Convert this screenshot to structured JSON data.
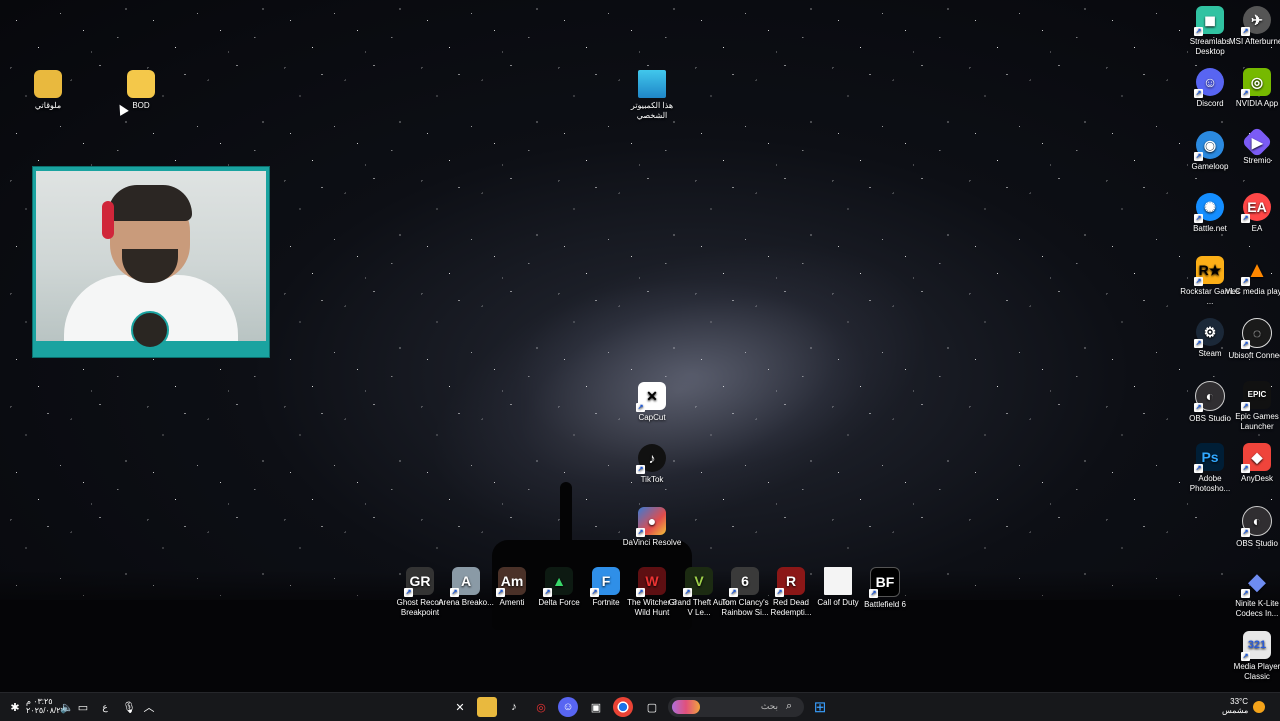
{
  "desktop": {
    "left_icons": [
      {
        "name": "folder-arabic",
        "label": "ملوقاتي"
      },
      {
        "name": "folder-bod",
        "label": "BOD"
      }
    ],
    "this_pc": {
      "label": "هذا الكمبيوتر الشخصي"
    },
    "center_icons": [
      {
        "label": "CapCut"
      },
      {
        "label": "TikTok"
      },
      {
        "label": "DaVinci Resolve"
      }
    ],
    "game_row": [
      {
        "label": "Ghost Recon Breakpoint"
      },
      {
        "label": "Arena Breako..."
      },
      {
        "label": "Amenti"
      },
      {
        "label": "Delta Force"
      },
      {
        "label": "Fortnite"
      },
      {
        "label": "The Witcher 3 Wild Hunt"
      },
      {
        "label": "Grand Theft Auto V Le..."
      },
      {
        "label": "Tom Clancy's Rainbow Si..."
      },
      {
        "label": "Red Dead Redempti..."
      },
      {
        "label": "Call of Duty"
      },
      {
        "label": "Battlefield 6"
      }
    ],
    "right_col1": [
      {
        "label": "Streamlabs Desktop"
      },
      {
        "label": "Discord"
      },
      {
        "label": "Gameloop"
      },
      {
        "label": "Battle.net"
      },
      {
        "label": "Rockstar Games ..."
      },
      {
        "label": "Steam"
      },
      {
        "label": "OBS Studio"
      },
      {
        "label": "Adobe Photosho..."
      }
    ],
    "right_col2": [
      {
        "label": "MSI Afterburner"
      },
      {
        "label": "NVIDIA App"
      },
      {
        "label": "Stremio"
      },
      {
        "label": "EA"
      },
      {
        "label": "VLC media player"
      },
      {
        "label": "Ubisoft Connect"
      },
      {
        "label": "Epic Games Launcher"
      },
      {
        "label": "AnyDesk"
      },
      {
        "label": "OBS Studio"
      },
      {
        "label": "Ninite K-Lite Codecs In..."
      },
      {
        "label": "Media Player Classic"
      }
    ]
  },
  "taskbar": {
    "search_placeholder": "بحث",
    "clock_time": "٠٣:٢٥ م",
    "clock_date": "٢٠٢٥/٠٨/٢٧",
    "lang": "ع",
    "weather_temp": "33°C",
    "weather_desc": "مشمس"
  }
}
